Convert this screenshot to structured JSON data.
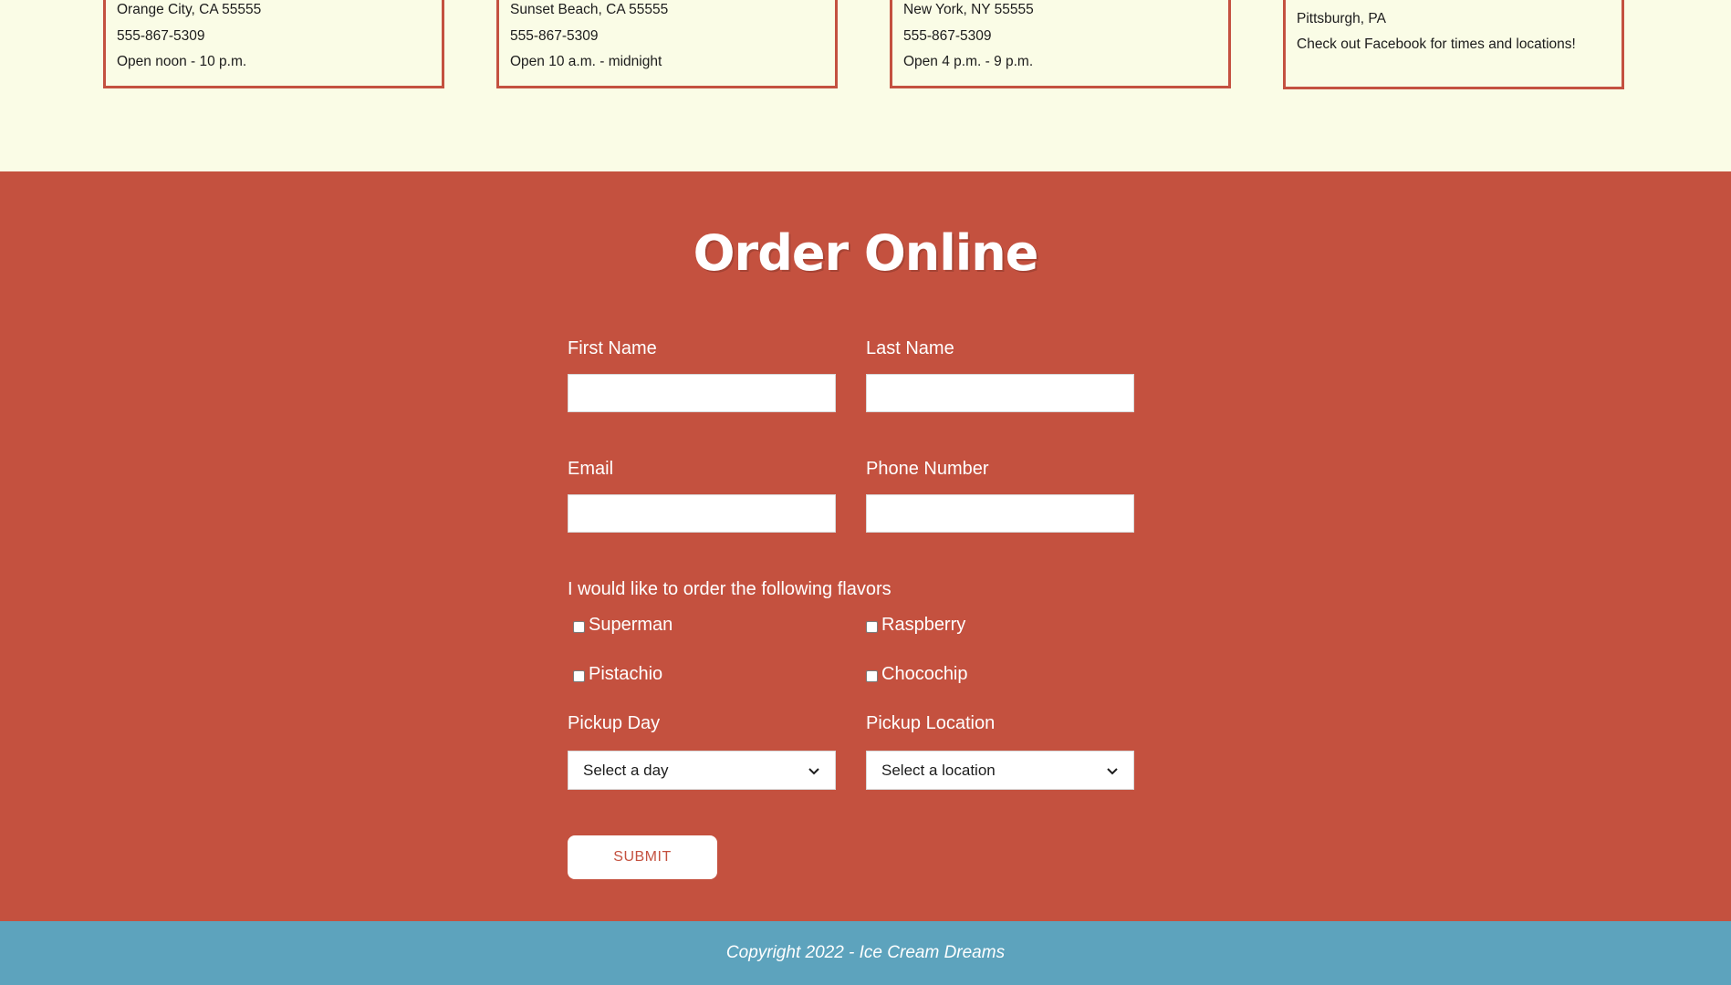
{
  "colors": {
    "background_cream": "#fafce6",
    "order_red": "#c4513f",
    "footer_blue": "#5da3bd",
    "text_white": "#ffffff"
  },
  "locations": [
    {
      "address": "Orange City, CA 55555",
      "phone": "555-867-5309",
      "hours": "Open noon - 10 p.m."
    },
    {
      "address": "Sunset Beach, CA 55555",
      "phone": "555-867-5309",
      "hours": "Open 10 a.m. - midnight"
    },
    {
      "address": "New York, NY 55555",
      "phone": "555-867-5309",
      "hours": "Open 4 p.m. - 9 p.m."
    },
    {
      "address": "Pittsburgh, PA",
      "note": "Check out Facebook for times and locations!"
    }
  ],
  "order": {
    "title": "Order Online",
    "first_name_label": "First Name",
    "last_name_label": "Last Name",
    "email_label": "Email",
    "phone_label": "Phone Number",
    "first_name_value": "",
    "last_name_value": "",
    "email_value": "",
    "phone_value": "",
    "flavors_label": "I would like to order the following flavors",
    "flavors": [
      {
        "label": "Superman",
        "checked": false
      },
      {
        "label": "Raspberry",
        "checked": false
      },
      {
        "label": "Pistachio",
        "checked": false
      },
      {
        "label": "Chocochip",
        "checked": false
      }
    ],
    "pickup_day_label": "Pickup Day",
    "pickup_day_selected": "Select a day",
    "pickup_location_label": "Pickup Location",
    "pickup_location_selected": "Select a location",
    "submit_label": "SUBMIT"
  },
  "footer": {
    "copyright": "Copyright 2022 - Ice Cream Dreams"
  }
}
